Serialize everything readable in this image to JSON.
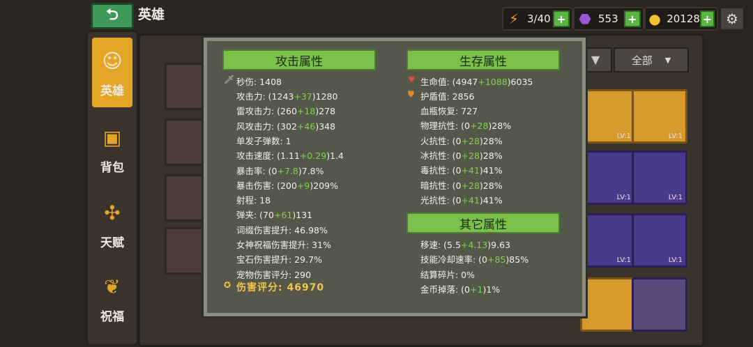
{
  "topbar": {
    "title": "英雄",
    "energy": "3/40",
    "gems": "553",
    "coins": "20128",
    "plus": "+"
  },
  "nav": {
    "hero": "英雄",
    "bag": "背包",
    "talent": "天赋",
    "blessing": "祝福"
  },
  "filter": {
    "all": "全部"
  },
  "grid": {
    "lv": "LV:1"
  },
  "attack": {
    "header": "攻击属性",
    "dps_label": "秒伤: 1408",
    "rows": [
      {
        "label": "攻击力: (1243",
        "bonus": "+37",
        "tail": ")1280"
      },
      {
        "label": "雷攻击力: (260",
        "bonus": "+18",
        "tail": ")278"
      },
      {
        "label": "风攻击力: (302",
        "bonus": "+46",
        "tail": ")348"
      },
      {
        "label": "单发子弹数: 1",
        "bonus": "",
        "tail": ""
      },
      {
        "label": "攻击速度: (1.11",
        "bonus": "+0.29",
        "tail": ")1.4"
      },
      {
        "label": "暴击率: (0",
        "bonus": "+7.8",
        "tail": ")7.8%"
      },
      {
        "label": "暴击伤害: (200",
        "bonus": "+9",
        "tail": ")209%"
      },
      {
        "label": "射程: 18",
        "bonus": "",
        "tail": ""
      },
      {
        "label": "弹夹: (70",
        "bonus": "+61",
        "tail": ")131"
      },
      {
        "label": "词缀伤害提升: 46.98%",
        "bonus": "",
        "tail": ""
      },
      {
        "label": "女神祝福伤害提升: 31%",
        "bonus": "",
        "tail": ""
      },
      {
        "label": "宝石伤害提升: 29.7%",
        "bonus": "",
        "tail": ""
      },
      {
        "label": "宠物伤害评分: 290",
        "bonus": "",
        "tail": ""
      }
    ],
    "score": "伤害评分: 46970"
  },
  "survival": {
    "header": "生存属性",
    "rows": [
      {
        "label": "生命值: (4947",
        "bonus": "+1088",
        "tail": ")6035"
      },
      {
        "label": "护盾值: 2856",
        "bonus": "",
        "tail": ""
      },
      {
        "label": "血瓶恢复: 727",
        "bonus": "",
        "tail": ""
      },
      {
        "label": "物理抗性: (0",
        "bonus": "+28",
        "tail": ")28%"
      },
      {
        "label": "火抗性: (0",
        "bonus": "+28",
        "tail": ")28%"
      },
      {
        "label": "冰抗性: (0",
        "bonus": "+28",
        "tail": ")28%"
      },
      {
        "label": "毒抗性: (0",
        "bonus": "+41",
        "tail": ")41%"
      },
      {
        "label": "暗抗性: (0",
        "bonus": "+28",
        "tail": ")28%"
      },
      {
        "label": "光抗性: (0",
        "bonus": "+41",
        "tail": ")41%"
      }
    ]
  },
  "other": {
    "header": "其它属性",
    "rows": [
      {
        "label": "移速: (5.5",
        "bonus": "+4.13",
        "tail": ")9.63"
      },
      {
        "label": "技能冷却速率: (0",
        "bonus": "+85",
        "tail": ")85%"
      },
      {
        "label": "结算碎片: 0%",
        "bonus": "",
        "tail": ""
      },
      {
        "label": "金币掉落: (0",
        "bonus": "+1",
        "tail": ")1%"
      }
    ]
  },
  "icons": [
    "back-arrow-icon",
    "lightning-icon",
    "gem-icon",
    "coin-icon",
    "gear-icon",
    "hero-icon",
    "bag-icon",
    "talent-icon",
    "blessing-icon",
    "sword-icon",
    "heart-icon",
    "shield-icon",
    "score-icon",
    "dropdown-icon"
  ]
}
